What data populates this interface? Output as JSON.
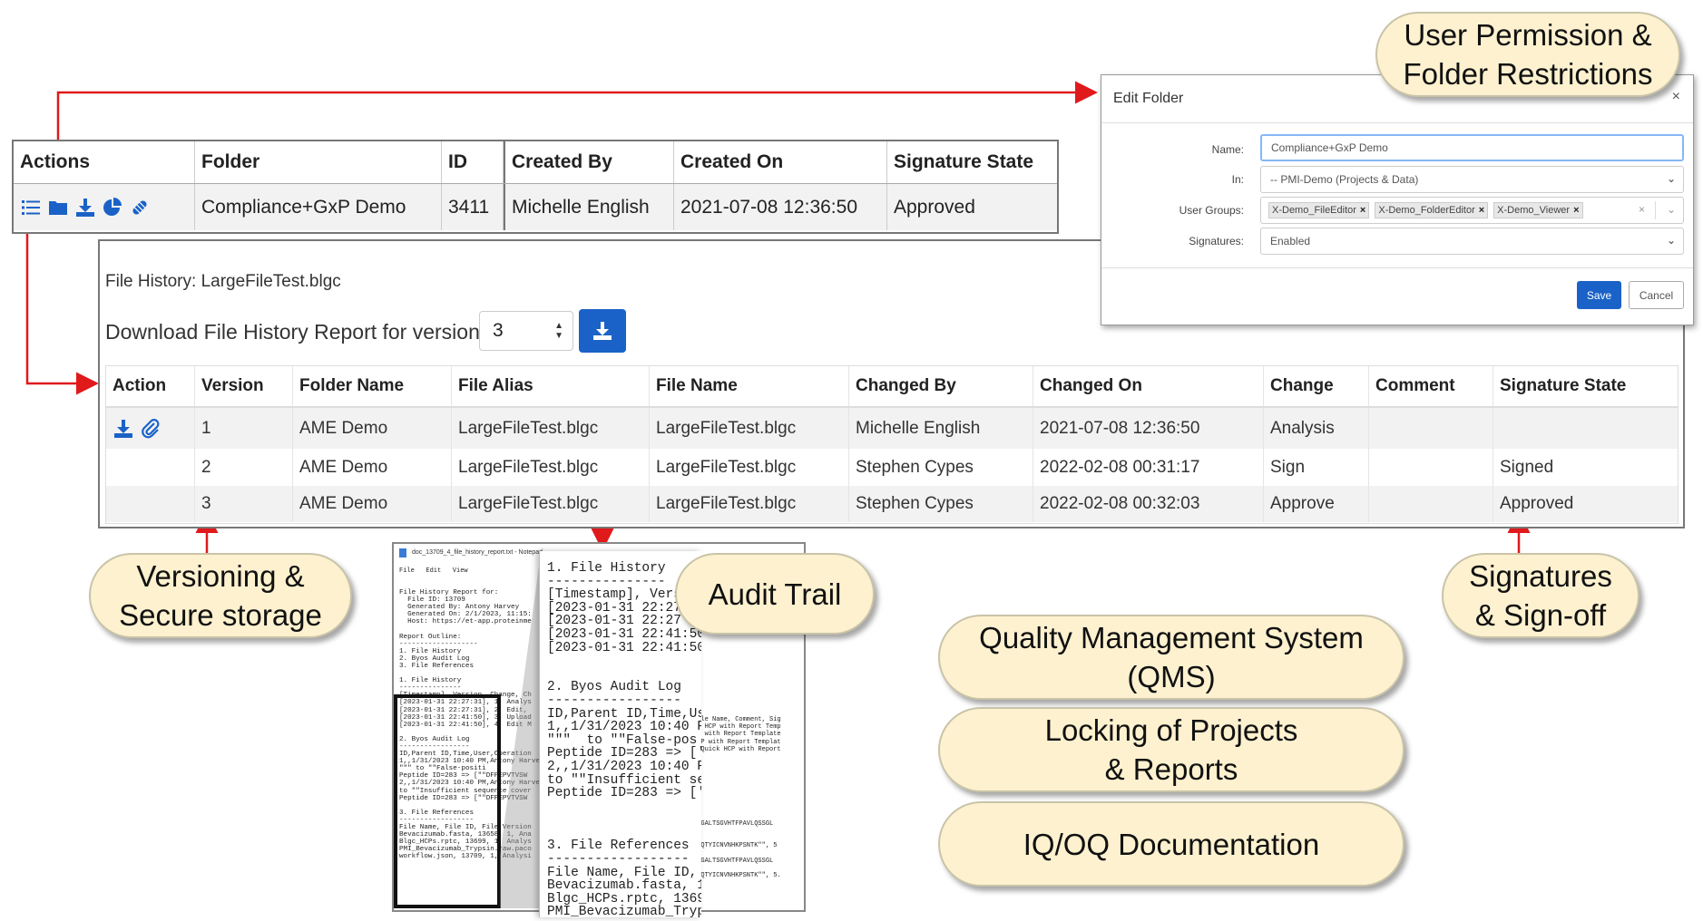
{
  "colors": {
    "accent": "#1a62c7",
    "arrow": "#e0191b",
    "callout_fill": "#fdf1cf"
  },
  "callouts": {
    "permission": "User Permission &\nFolder Restrictions",
    "versioning": "Versioning &\nSecure storage",
    "audit": "Audit Trail",
    "signatures": "Signatures\n& Sign-off",
    "qms": "Quality Management System\n(QMS)",
    "locking": "Locking of Projects\n& Reports",
    "iqoq": "IQ/OQ Documentation"
  },
  "folder_table": {
    "headers": [
      "Actions",
      "Folder",
      "ID",
      "Created By",
      "Created On",
      "Signature State"
    ],
    "row": {
      "folder": "Compliance+GxP Demo",
      "id": "3411",
      "created_by": "Michelle English",
      "created_on": "2021-07-08 12:36:50",
      "signature_state": "Approved"
    },
    "action_icons": [
      "list-icon",
      "folder-icon",
      "download-icon",
      "pie-chart-icon",
      "pill-icon"
    ]
  },
  "file_history": {
    "title": "File History: LargeFileTest.blgc",
    "download_label": "Download File History Report for version",
    "version_value": "3",
    "headers": [
      "Action",
      "Version",
      "Folder Name",
      "File Alias",
      "File Name",
      "Changed By",
      "Changed On",
      "Change",
      "Comment",
      "Signature State"
    ],
    "rows": [
      [
        "",
        "1",
        "AME Demo",
        "LargeFileTest.blgc",
        "LargeFileTest.blgc",
        "Michelle English",
        "2021-07-08 12:36:50",
        "Analysis",
        "",
        ""
      ],
      [
        "",
        "2",
        "AME Demo",
        "LargeFileTest.blgc",
        "LargeFileTest.blgc",
        "Stephen Cypes",
        "2022-02-08 00:31:17",
        "Sign",
        "",
        "Signed"
      ],
      [
        "",
        "3",
        "AME Demo",
        "LargeFileTest.blgc",
        "LargeFileTest.blgc",
        "Stephen Cypes",
        "2022-02-08 00:32:03",
        "Approve",
        "",
        "Approved"
      ]
    ]
  },
  "edit_folder": {
    "title": "Edit Folder",
    "close": "×",
    "name_label": "Name:",
    "name_value": "Compliance+GxP Demo",
    "in_label": "In:",
    "in_value": "-- PMI-Demo (Projects & Data)",
    "groups_label": "User Groups:",
    "groups": [
      "X-Demo_FileEditor",
      "X-Demo_FolderEditor",
      "X-Demo_Viewer"
    ],
    "signatures_label": "Signatures:",
    "signatures_value": "Enabled",
    "save": "Save",
    "cancel": "Cancel"
  },
  "notepad": {
    "title": "doc_13709_4_file_history_report.txt - Notepad",
    "menu": "File   Edit   View",
    "body": "File History Report for:\n  File ID: 13709\n  Generated By: Antony Harvey\n  Generated On: 2/1/2023, 11:15:\n  Host: https://et-app.proteinme\n\nReport Outline:\n-------------------\n1. File History\n2. Byos Audit Log\n3. File References\n\n1. File History\n---------------\n[Timestamp], Version, Change, Ch\n[2023-01-31 22:27:31], 1, Analys\n[2023-01-31 22:27:31], 2, Edit,\n[2023-01-31 22:41:50], 3, Upload\n[2023-01-31 22:41:50], 4, Edit M\n\n2. Byos Audit Log\n-----------------\nID,Parent ID,Time,User,Operation\n1,,1/31/2023 10:40 PM,Antony Harve\n\"\"\" to \"\"False-positi\nPeptide ID=283 => [\"\"DFPEPVTVSW\n2,,1/31/2023 10:40 PM,Antony Harve\nto \"\"Insufficient sequence cover\nPeptide ID=283 => [\"\"DFPEPVTVSW\n\n3. File References\n------------------\nFile Name, File ID, File Version\nBevacizumab.fasta, 13658, 1, Ana\nBlgc_HCPs.rptc, 13699, 1, Analys\nPMI_Bevacizumab_Trypsin.raw.paco\nworkflow.json, 13709, 1, Analysi",
    "right_body": "File Name, Comment, Sig\nck HCP with Report Temp\ncp with Report Template\nHCP with Report Templat\n, Quick HCP with Report\n\n\n\n\n\n\n\n\n\nNSGALTSGVHTFPAVLQSSGL\n\n\nGTQTYICNVNHKPSNTK\"\", 5\n\nNSGALTSGVHTFPAVLQSSGL\n\nGTQTYICNVNHKPSNTK\"\", 5.",
    "zoom_body": "1. File History\n---------------\n[Timestamp], Vers\n[2023-01-31 22:27\n[2023-01-31 22:27\n[2023-01-31 22:41:50\n[2023-01-31 22:41:50\n\n\n2. Byos Audit Log\n-----------------\nID,Parent ID,Time,Us\n1,,1/31/2023 10:40 P\n\"\"\"  to \"\"False-pos\nPeptide ID=283 => ['\n2,,1/31/2023 10:40 P\nto \"\"Insufficient se\nPeptide ID=283 => ['\n\n\n\n3. File References\n------------------\nFile Name, File ID,\nBevacizumab.fasta, 1\nBlgc_HCPs.rptc, 1369\nPMI_Bevacizumab_Tryp\nworkflow.json, 13709"
  }
}
